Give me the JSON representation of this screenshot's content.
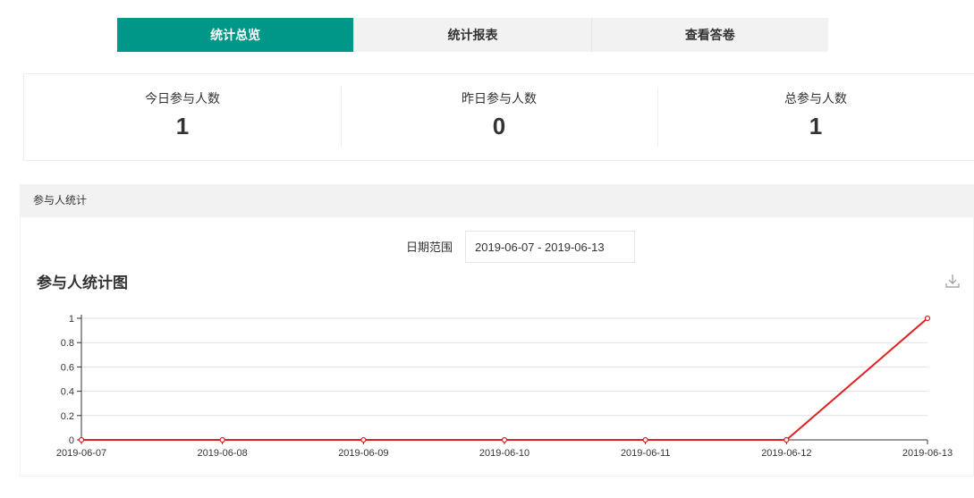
{
  "tabs": [
    {
      "label": "统计总览",
      "active": true
    },
    {
      "label": "统计报表",
      "active": false
    },
    {
      "label": "查看答卷",
      "active": false
    }
  ],
  "stats": [
    {
      "label": "今日参与人数",
      "value": "1"
    },
    {
      "label": "昨日参与人数",
      "value": "0"
    },
    {
      "label": "总参与人数",
      "value": "1"
    }
  ],
  "panel": {
    "title": "参与人统计",
    "date_label": "日期范围",
    "date_value": "2019-06-07 - 2019-06-13"
  },
  "chart_title": "参与人统计图",
  "colors": {
    "accent": "#009688",
    "line": "#e02020"
  },
  "chart_data": {
    "type": "line",
    "x": [
      "2019-06-07",
      "2019-06-08",
      "2019-06-09",
      "2019-06-10",
      "2019-06-11",
      "2019-06-12",
      "2019-06-13"
    ],
    "series": [
      {
        "values": [
          0,
          0,
          0,
          0,
          0,
          0,
          1
        ]
      }
    ],
    "ylim": [
      0,
      1
    ],
    "yticks": [
      "0",
      "0.2",
      "0.4",
      "0.6",
      "0.8",
      "1"
    ],
    "grid": true
  }
}
